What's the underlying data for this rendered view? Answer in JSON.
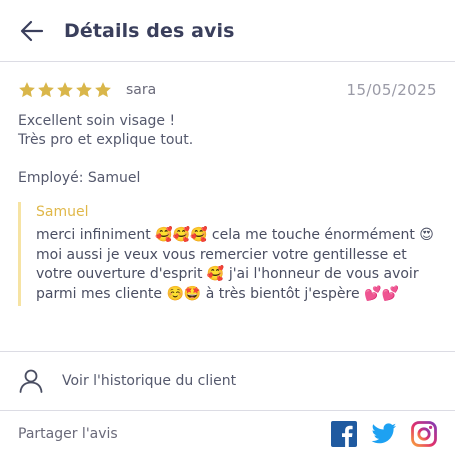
{
  "header": {
    "title": "Détails des avis",
    "back_icon": "arrow-left-icon"
  },
  "review": {
    "rating": 5,
    "rating_max": 5,
    "star_color": "#d9b64a",
    "author": "sara",
    "date": "15/05/2025",
    "comment": "Excellent soin visage !\nTrès pro et explique tout.",
    "employee_label": "Employé: Samuel"
  },
  "reply": {
    "author": "Samuel",
    "author_color": "#e0b84a",
    "border_color": "#f6e3a3",
    "text": "merci infiniment 🥰🥰🥰 cela me touche énormément 😍 moi aussi je veux vous remercier votre gentillesse et votre ouverture d'esprit 🥰 j'ai l'honneur de vous avoir parmi mes cliente ☺️🤩 à très bientôt j'espère 💕💕"
  },
  "history": {
    "label": "Voir l'historique du client",
    "icon": "user-icon"
  },
  "share": {
    "label": "Partager l'avis",
    "icons": [
      "facebook-icon",
      "twitter-icon",
      "instagram-icon"
    ],
    "facebook_color": "#1f5aa0",
    "twitter_color": "#1da1f2",
    "instagram_color": "#c13584"
  }
}
